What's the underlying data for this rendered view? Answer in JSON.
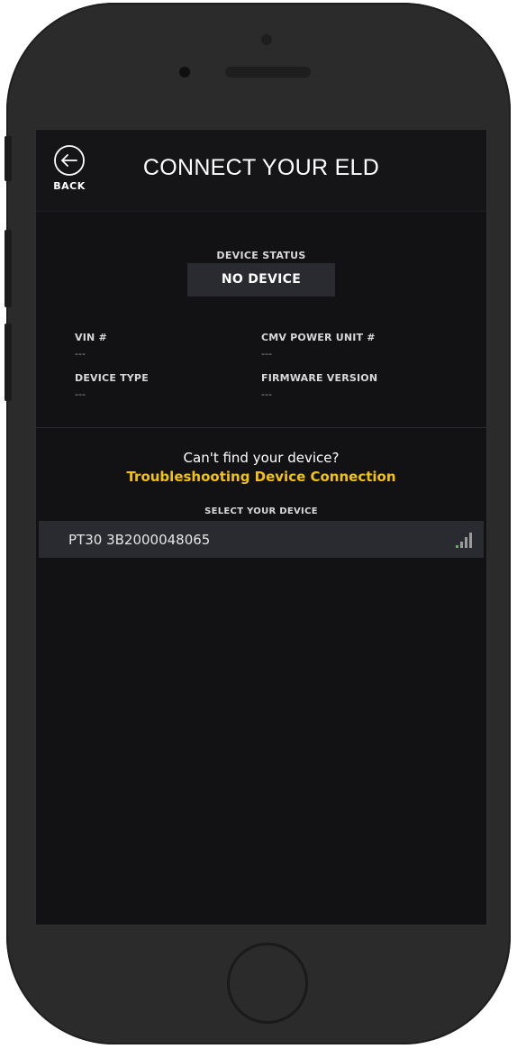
{
  "header": {
    "back_label": "BACK",
    "title": "CONNECT YOUR ELD",
    "back_icon": "arrow-left-circle-icon"
  },
  "device_status": {
    "label": "DEVICE STATUS",
    "value": "NO DEVICE"
  },
  "info": {
    "vin_label": "VIN #",
    "vin_value": "---",
    "cmv_label": "CMV POWER UNIT #",
    "cmv_value": "---",
    "device_type_label": "DEVICE TYPE",
    "device_type_value": "---",
    "firmware_label": "FIRMWARE VERSION",
    "firmware_value": "---"
  },
  "help": {
    "question": "Can't find your device?",
    "link": "Troubleshooting Device Connection"
  },
  "device_list": {
    "label": "SELECT YOUR DEVICE",
    "items": [
      {
        "name": "PT30 3B2000048065",
        "signal_icon": "signal-strength-icon",
        "signal_bars_active": 1,
        "signal_bars_total": 4
      }
    ]
  },
  "colors": {
    "accent": "#f4c20d",
    "signal_active": "#5cb85c",
    "signal_inactive": "#9a9a9a"
  }
}
